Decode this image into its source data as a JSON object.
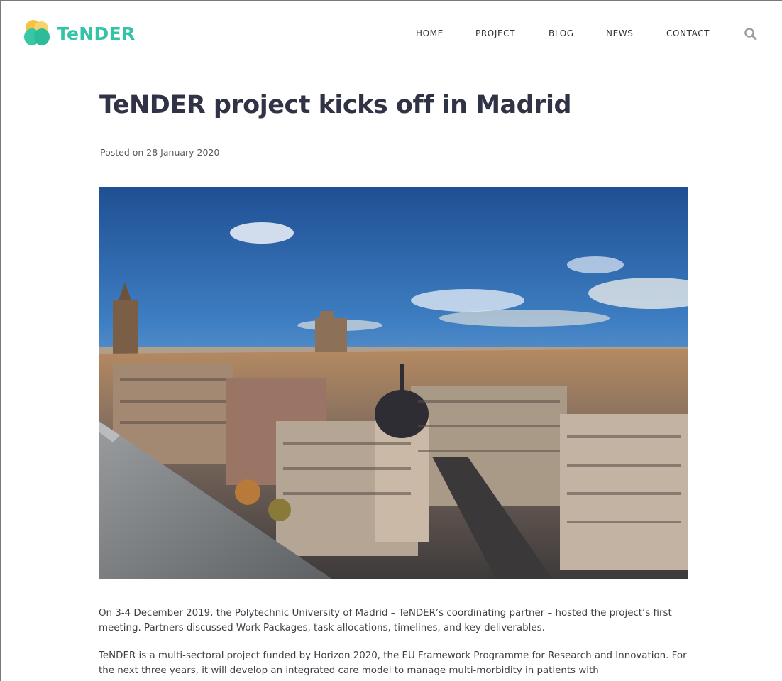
{
  "brand": {
    "name": "TeNDER",
    "colors": {
      "primary": "#35c3a6",
      "accent": "#f5c244"
    }
  },
  "nav": {
    "items": [
      {
        "label": "HOME"
      },
      {
        "label": "PROJECT"
      },
      {
        "label": "BLOG"
      },
      {
        "label": "NEWS"
      },
      {
        "label": "CONTACT"
      }
    ],
    "search_icon": "search-icon"
  },
  "article": {
    "title": "TeNDER project kicks off in Madrid",
    "meta": "Posted on 28 January 2020",
    "hero_image": "city-skyline-photo",
    "paragraphs": [
      "On 3-4 December 2019, the Polytechnic University of Madrid – TeNDER’s coordinating partner – hosted the project’s first meeting. Partners discussed Work Packages, task allocations, timelines, and key deliverables.",
      "TeNDER is a multi-sectoral project funded by Horizon 2020, the EU Framework Programme for Research and Innovation. For the next three years, it will develop an integrated care model to manage multi-morbidity in patients with"
    ]
  }
}
